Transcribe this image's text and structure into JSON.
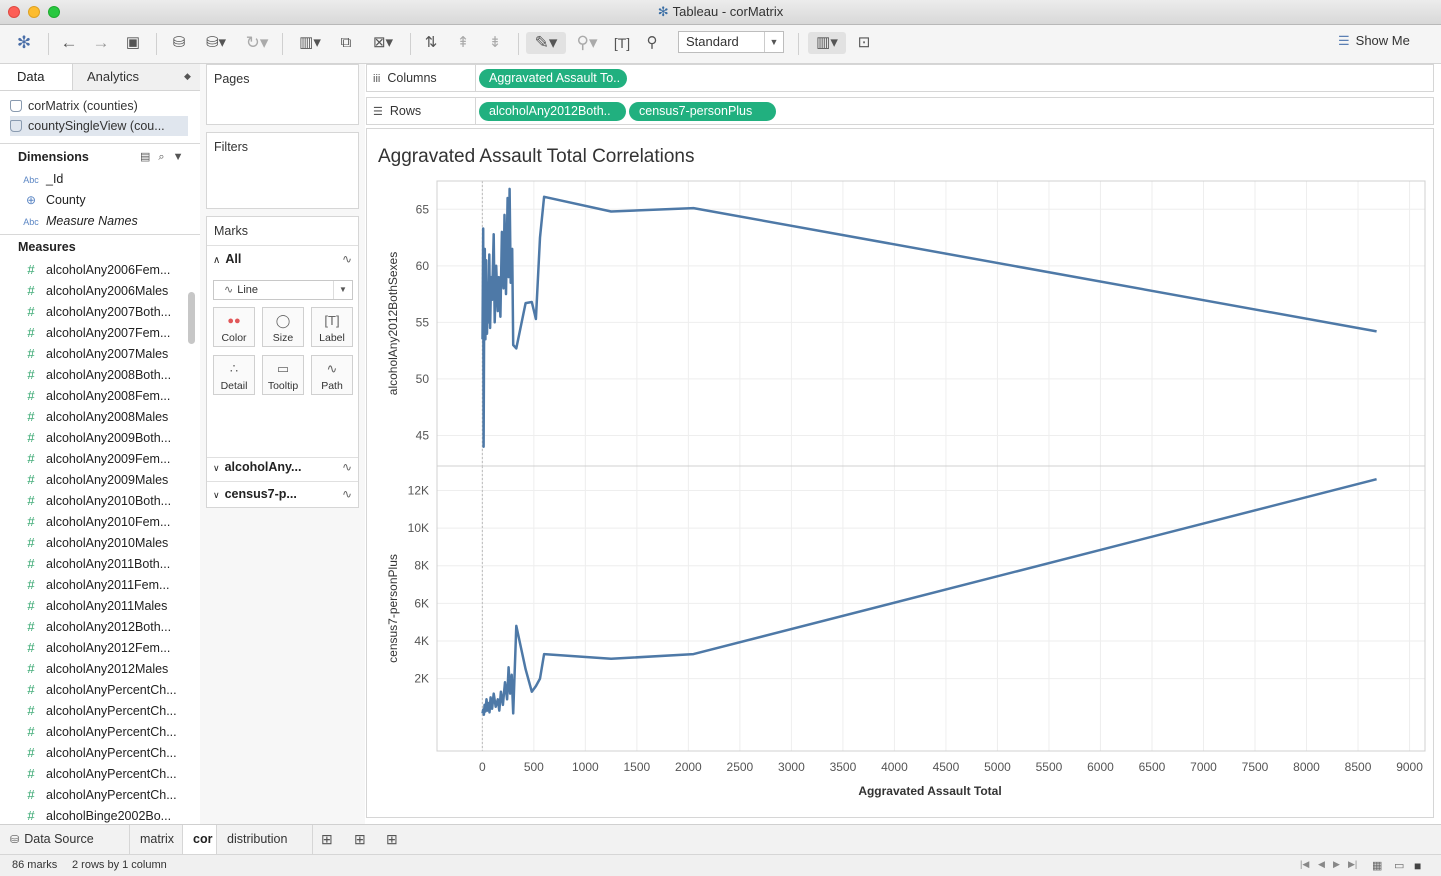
{
  "window": {
    "title": "Tableau - corMatrix"
  },
  "toolbar": {
    "fit_select": "Standard",
    "show_me": "Show Me"
  },
  "datapane": {
    "tabs": {
      "data": "Data",
      "analytics": "Analytics"
    },
    "datasources": [
      "corMatrix (counties)",
      "countySingleView (cou..."
    ],
    "dimensions_header": "Dimensions",
    "dimensions": [
      {
        "type": "Abc",
        "name": "_Id",
        "italic": false
      },
      {
        "type": "geo",
        "name": "County",
        "italic": false
      },
      {
        "type": "Abc",
        "name": "Measure Names",
        "italic": true
      }
    ],
    "measures_header": "Measures",
    "measures": [
      "alcoholAny2006Fem...",
      "alcoholAny2006Males",
      "alcoholAny2007Both...",
      "alcoholAny2007Fem...",
      "alcoholAny2007Males",
      "alcoholAny2008Both...",
      "alcoholAny2008Fem...",
      "alcoholAny2008Males",
      "alcoholAny2009Both...",
      "alcoholAny2009Fem...",
      "alcoholAny2009Males",
      "alcoholAny2010Both...",
      "alcoholAny2010Fem...",
      "alcoholAny2010Males",
      "alcoholAny2011Both...",
      "alcoholAny2011Fem...",
      "alcoholAny2011Males",
      "alcoholAny2012Both...",
      "alcoholAny2012Fem...",
      "alcoholAny2012Males",
      "alcoholAnyPercentCh...",
      "alcoholAnyPercentCh...",
      "alcoholAnyPercentCh...",
      "alcoholAnyPercentCh...",
      "alcoholAnyPercentCh...",
      "alcoholAnyPercentCh...",
      "alcoholBinge2002Bo..."
    ]
  },
  "cards": {
    "pages": "Pages",
    "filters": "Filters",
    "marks": "Marks",
    "marks_all": "All",
    "mark_type": "Line",
    "buttons": [
      "Color",
      "Size",
      "Label",
      "Detail",
      "Tooltip",
      "Path"
    ],
    "marks_sub": [
      "alcoholAny...",
      "census7-p..."
    ]
  },
  "shelves": {
    "columns_label": "Columns",
    "rows_label": "Rows",
    "columns_pills": [
      "Aggravated Assault To.."
    ],
    "rows_pills": [
      "alcoholAny2012Both..",
      "census7-personPlus"
    ]
  },
  "sheets": {
    "datasource_tab": "Data Source",
    "tabs": [
      "matrix",
      "cor",
      "distribution"
    ],
    "active": "cor"
  },
  "status": {
    "marks": "86 marks",
    "layout": "2 rows by 1 column"
  },
  "chart_data": {
    "type": "line",
    "title": "Aggravated Assault Total Correlations",
    "xlabel": "Aggravated Assault Total",
    "xlim": [
      -440,
      9150
    ],
    "xticks": [
      0,
      500,
      1000,
      1500,
      2000,
      2500,
      3000,
      3500,
      4000,
      4500,
      5000,
      5500,
      6000,
      6500,
      7000,
      7500,
      8000,
      8500,
      9000
    ],
    "xtick_labels": [
      "0",
      "500",
      "1000",
      "1500",
      "2000",
      "2500",
      "3000",
      "3500",
      "4000",
      "4500",
      "5000",
      "5500",
      "6000",
      "6500",
      "7000",
      "7500",
      "8000",
      "8500",
      "9000"
    ],
    "color": "#4e79a7",
    "grid": true,
    "panes": [
      {
        "ylabel": "alcoholAny2012BothSexes",
        "ylim": [
          42.3,
          67.5
        ],
        "yticks": [
          45,
          50,
          55,
          60,
          65
        ],
        "ytick_labels": [
          "45",
          "50",
          "55",
          "60",
          "65"
        ],
        "x": [
          2,
          8,
          12,
          18,
          24,
          30,
          38,
          45,
          52,
          60,
          68,
          75,
          85,
          95,
          110,
          120,
          135,
          150,
          160,
          175,
          190,
          205,
          215,
          230,
          245,
          255,
          265,
          275,
          290,
          300,
          330,
          420,
          480,
          520,
          560,
          600,
          1250,
          2050,
          8680
        ],
        "y": [
          53.5,
          63.3,
          44.0,
          56.0,
          61.5,
          53.5,
          60.5,
          54.0,
          58.5,
          55.0,
          61.0,
          54.5,
          59.0,
          57.0,
          62.8,
          55.0,
          60.0,
          56.0,
          59.0,
          55.5,
          63.0,
          58.0,
          64.5,
          57.5,
          66.0,
          59.0,
          66.8,
          58.5,
          61.5,
          53.0,
          52.7,
          56.7,
          56.8,
          55.3,
          62.5,
          66.1,
          64.8,
          65.1,
          54.2
        ]
      },
      {
        "ylabel": "census7-personPlus",
        "ylim": [
          -1850,
          13300
        ],
        "yticks": [
          2000,
          4000,
          6000,
          8000,
          10000,
          12000
        ],
        "ytick_labels": [
          "2K",
          "4K",
          "6K",
          "8K",
          "10K",
          "12K"
        ],
        "x": [
          2,
          8,
          15,
          22,
          30,
          40,
          50,
          60,
          70,
          80,
          95,
          110,
          130,
          150,
          165,
          180,
          200,
          220,
          240,
          255,
          270,
          285,
          300,
          330,
          420,
          480,
          520,
          560,
          600,
          1250,
          2050,
          8680
        ],
        "y": [
          150,
          350,
          80,
          600,
          250,
          900,
          300,
          700,
          200,
          1000,
          400,
          1200,
          500,
          900,
          300,
          1300,
          600,
          1800,
          900,
          2600,
          1200,
          2200,
          150,
          4800,
          2500,
          1300,
          1600,
          2000,
          3300,
          3050,
          3300,
          12600
        ]
      }
    ]
  }
}
